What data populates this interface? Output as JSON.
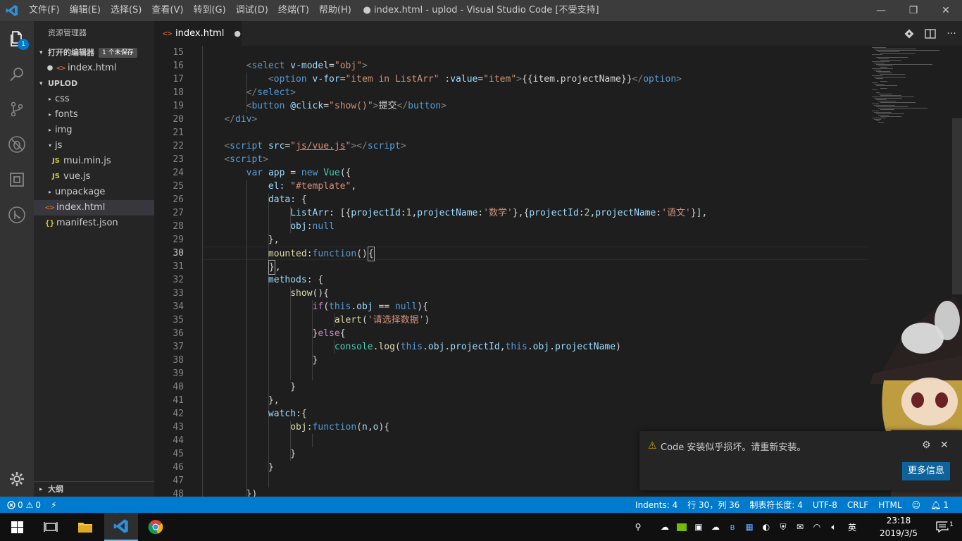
{
  "window": {
    "title": "● index.html - uplod - Visual Studio Code [不受支持]",
    "minimize": "—",
    "maximize": "❐",
    "close": "✕"
  },
  "menu": [
    "文件(F)",
    "编辑(E)",
    "选择(S)",
    "查看(V)",
    "转到(G)",
    "调试(D)",
    "终端(T)",
    "帮助(H)"
  ],
  "activity": {
    "badge": "1",
    "icons": [
      "files-icon",
      "search-icon",
      "source-control-icon",
      "debug-icon",
      "extensions-icon",
      "remote-icon"
    ],
    "manage_icon": "gear-icon"
  },
  "sidebar": {
    "title": "资源管理器",
    "open_editors": {
      "label": "打开的编辑器",
      "badge": "1 个未保存",
      "files": [
        {
          "name": "index.html",
          "icon": "<>"
        }
      ]
    },
    "project": {
      "label": "UPLOD",
      "items": [
        {
          "name": "css",
          "type": "folder",
          "twisty": "▸"
        },
        {
          "name": "fonts",
          "type": "folder",
          "twisty": "▸"
        },
        {
          "name": "img",
          "type": "folder",
          "twisty": "▸"
        },
        {
          "name": "js",
          "type": "folder",
          "twisty": "▾"
        },
        {
          "name": "mui.min.js",
          "type": "js",
          "icon": "JS"
        },
        {
          "name": "vue.js",
          "type": "js",
          "icon": "JS"
        },
        {
          "name": "unpackage",
          "type": "folder",
          "twisty": "▸"
        },
        {
          "name": "index.html",
          "type": "html",
          "icon": "<>"
        },
        {
          "name": "manifest.json",
          "type": "json",
          "icon": "{}"
        }
      ]
    },
    "outline": "大纲"
  },
  "tab": {
    "label": "index.html",
    "icon": "<>",
    "dirty": "●"
  },
  "editor": {
    "current_line": 30,
    "line_numbers": [
      "15",
      "16",
      "17",
      "18",
      "19",
      "20",
      "21",
      "22",
      "23",
      "24",
      "25",
      "26",
      "27",
      "28",
      "29",
      "30",
      "31",
      "32",
      "33",
      "34",
      "35",
      "36",
      "37",
      "38",
      "39",
      "40",
      "41",
      "42",
      "43",
      "44",
      "45",
      "46",
      "47",
      "48"
    ]
  },
  "notification": {
    "message": "Code 安装似乎损坏。请重新安装。",
    "button": "更多信息"
  },
  "status": {
    "errors": "0",
    "warnings": "0",
    "indents": "Indents: 4",
    "position": "行 30，列 36",
    "tab_size": "制表符长度: 4",
    "encoding": "UTF-8",
    "eol": "CRLF",
    "language": "HTML",
    "bell_count": "1"
  },
  "taskbar": {
    "time": "23:18",
    "date": "2019/3/5",
    "ime": "英"
  }
}
